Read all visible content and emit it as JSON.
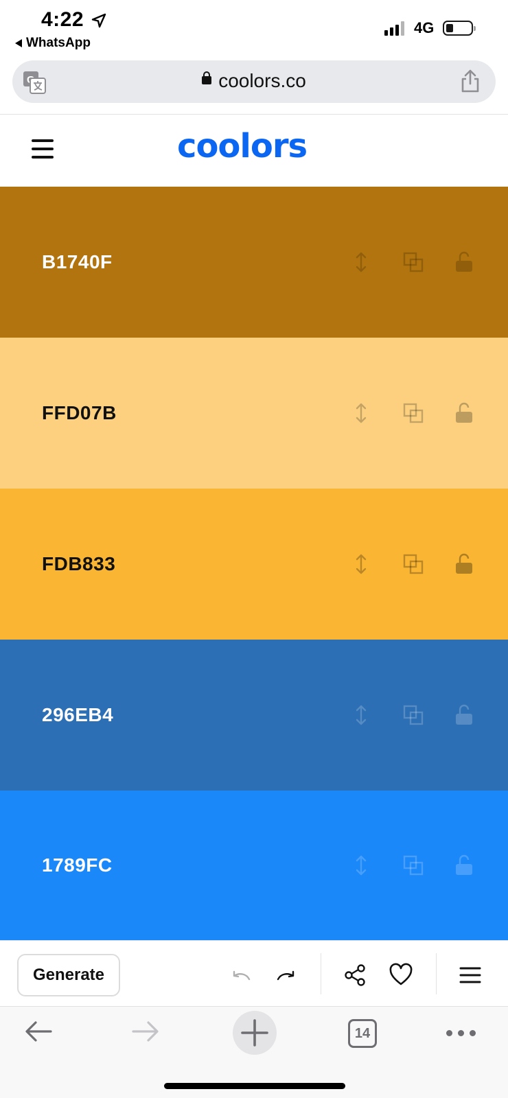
{
  "status_bar": {
    "time": "4:22",
    "back_app": "WhatsApp",
    "network": "4G",
    "icons": [
      "location-arrow-icon",
      "signal-icon",
      "battery-icon"
    ]
  },
  "url_bar": {
    "url": "coolors.co",
    "icons": [
      "translate-icon",
      "lock-icon",
      "share-icon"
    ]
  },
  "app_header": {
    "logo": "coolors",
    "logo_color": "#0b66f2",
    "menu_icon": "hamburger-icon"
  },
  "palette": {
    "swatches": [
      {
        "hex": "B1740F",
        "color": "#B1740F",
        "text_color": "#ffffff"
      },
      {
        "hex": "FFD07B",
        "color": "#FCD07F",
        "text_color": "#111111"
      },
      {
        "hex": "FDB833",
        "color": "#FAB533",
        "text_color": "#111111"
      },
      {
        "hex": "296EB4",
        "color": "#2C6FB4",
        "text_color": "#ffffff"
      },
      {
        "hex": "1789FC",
        "color": "#1B88FA",
        "text_color": "#ffffff"
      }
    ],
    "swatch_icons": [
      "drag-arrows-icon",
      "copy-icon",
      "unlock-icon"
    ]
  },
  "toolbar": {
    "generate_label": "Generate",
    "icons": [
      "undo-icon",
      "redo-icon",
      "share-nodes-icon",
      "heart-icon",
      "menu-icon"
    ]
  },
  "browser_bar": {
    "tabs_count": "14",
    "icons": [
      "back-arrow-icon",
      "forward-arrow-icon",
      "new-tab-plus-icon",
      "tabs-icon",
      "more-dots-icon"
    ]
  }
}
